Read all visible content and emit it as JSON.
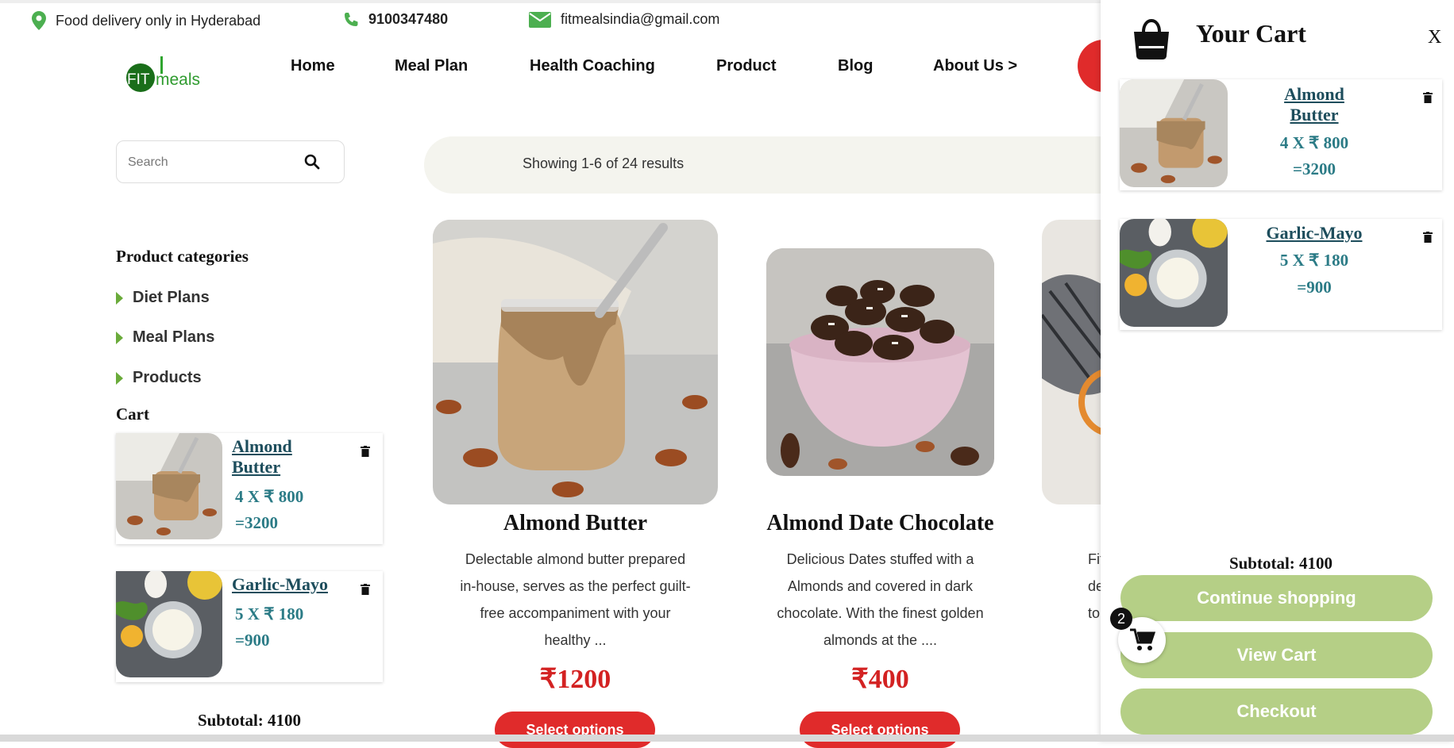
{
  "topbar": {
    "location": "Food delivery only in Hyderabad",
    "phone": "9100347480",
    "email": "fitmealsindia@gmail.com"
  },
  "logo": {
    "text_left": "FIT",
    "text_right": "meals"
  },
  "nav": [
    "Home",
    "Meal Plan",
    "Health Coaching",
    "Product",
    "Blog",
    "About Us >"
  ],
  "search": {
    "placeholder": "Search"
  },
  "sidebar": {
    "categories_heading": "Product categories",
    "categories": [
      "Diet Plans",
      "Meal Plans",
      "Products"
    ],
    "cart_heading": "Cart",
    "cart_items": [
      {
        "name_line1": "Almond",
        "name_line2": "Butter",
        "qty": "4 X ₹ 800",
        "total": "=3200"
      },
      {
        "name": "Garlic-Mayo",
        "qty": "5 X ₹ 180",
        "total": "=900"
      }
    ],
    "subtotal": "Subtotal: 4100"
  },
  "results": "Showing 1-6 of 24 results",
  "products": [
    {
      "title": "Almond Butter",
      "desc": [
        "Delectable almond butter prepared",
        "in-house, serves as the perfect guilt-",
        "free accompaniment with your",
        "healthy ..."
      ],
      "price": "₹1200",
      "button": "Select options"
    },
    {
      "title": "Almond Date Chocolate",
      "desc": [
        "Delicious Dates stuffed with a",
        "Almonds and covered in dark",
        "chocolate. With the finest golden",
        "almonds at the ...."
      ],
      "price": "₹400",
      "button": "Select options"
    },
    {
      "desc_partial": [
        "Fit",
        "de",
        "to"
      ]
    }
  ],
  "cart_panel": {
    "title": "Your Cart",
    "close": "X",
    "items": [
      {
        "name_line1": "Almond",
        "name_line2": "Butter",
        "qty": "4 X ₹ 800",
        "total": "=3200"
      },
      {
        "name": "Garlic-Mayo",
        "qty": "5 X ₹ 180",
        "total": "=900"
      }
    ],
    "subtotal": "Subtotal: 4100",
    "continue": "Continue shopping",
    "view_cart": "View Cart",
    "checkout": "Checkout"
  },
  "cart_badge": "2",
  "colors": {
    "brand_green": "#1a7a1a",
    "accent_red": "#e02b2b",
    "button_green": "#b5cf86",
    "item_teal": "#2b7b86",
    "link_dark": "#1d4d5c"
  },
  "icons": [
    "location-pin-icon",
    "phone-icon",
    "envelope-icon",
    "search-icon",
    "shopping-bag-icon",
    "trash-icon",
    "cart-icon"
  ]
}
